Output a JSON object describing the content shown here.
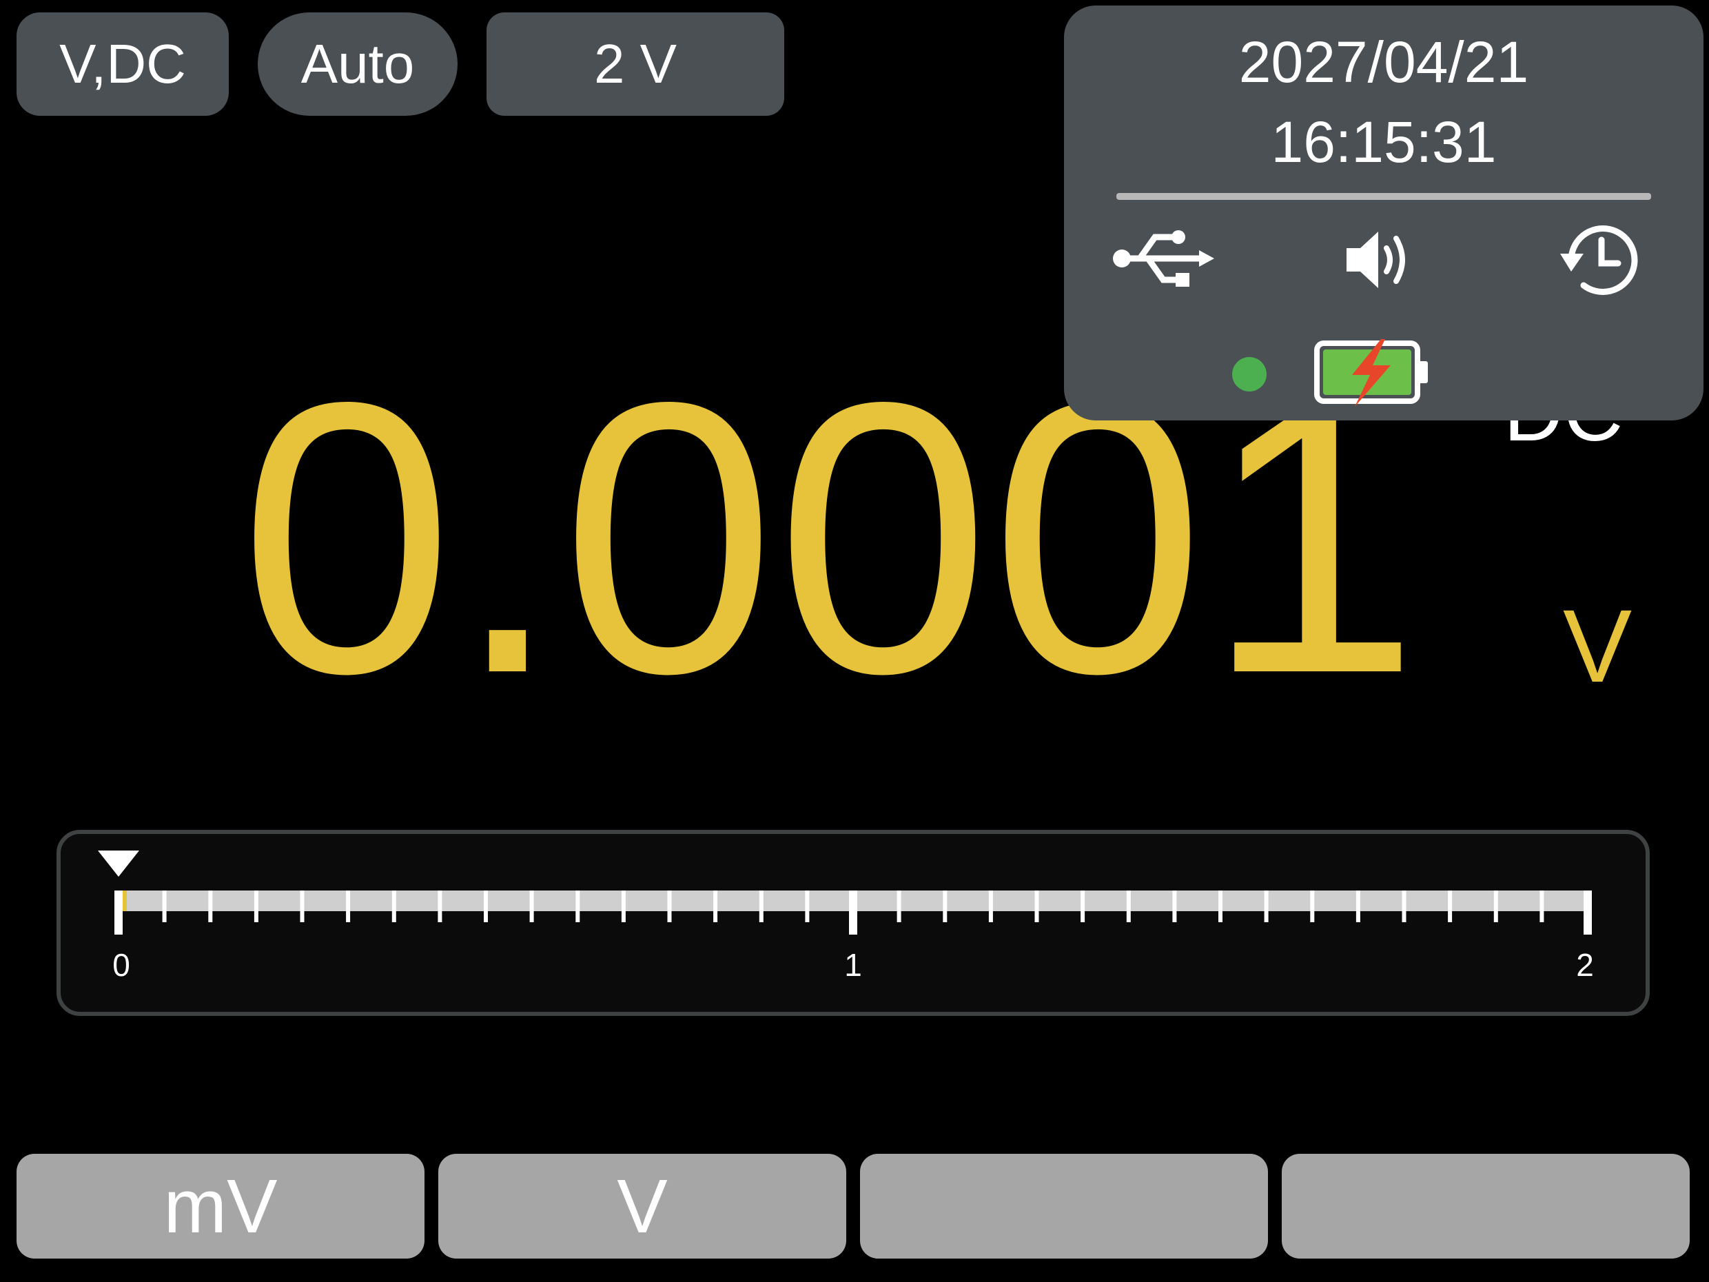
{
  "header": {
    "mode_label": "V,DC",
    "autorange_label": "Auto",
    "range_label": "2 V"
  },
  "status": {
    "date": "2027/04/21",
    "time": "16:15:31",
    "icons": [
      "usb-icon",
      "speaker-icon",
      "history-icon",
      "status-led",
      "battery-charging-icon"
    ],
    "led_color": "#4caf50"
  },
  "display": {
    "reading": "0.0001",
    "unit": "V",
    "coupling": "DC",
    "reading_color": "#e6c33b"
  },
  "bargraph": {
    "min": 0,
    "max": 2,
    "tick_labels": [
      "0",
      "1",
      "2"
    ],
    "value_fraction": 5e-05
  },
  "softkeys": {
    "labels": [
      "mV",
      "V",
      "",
      ""
    ]
  }
}
